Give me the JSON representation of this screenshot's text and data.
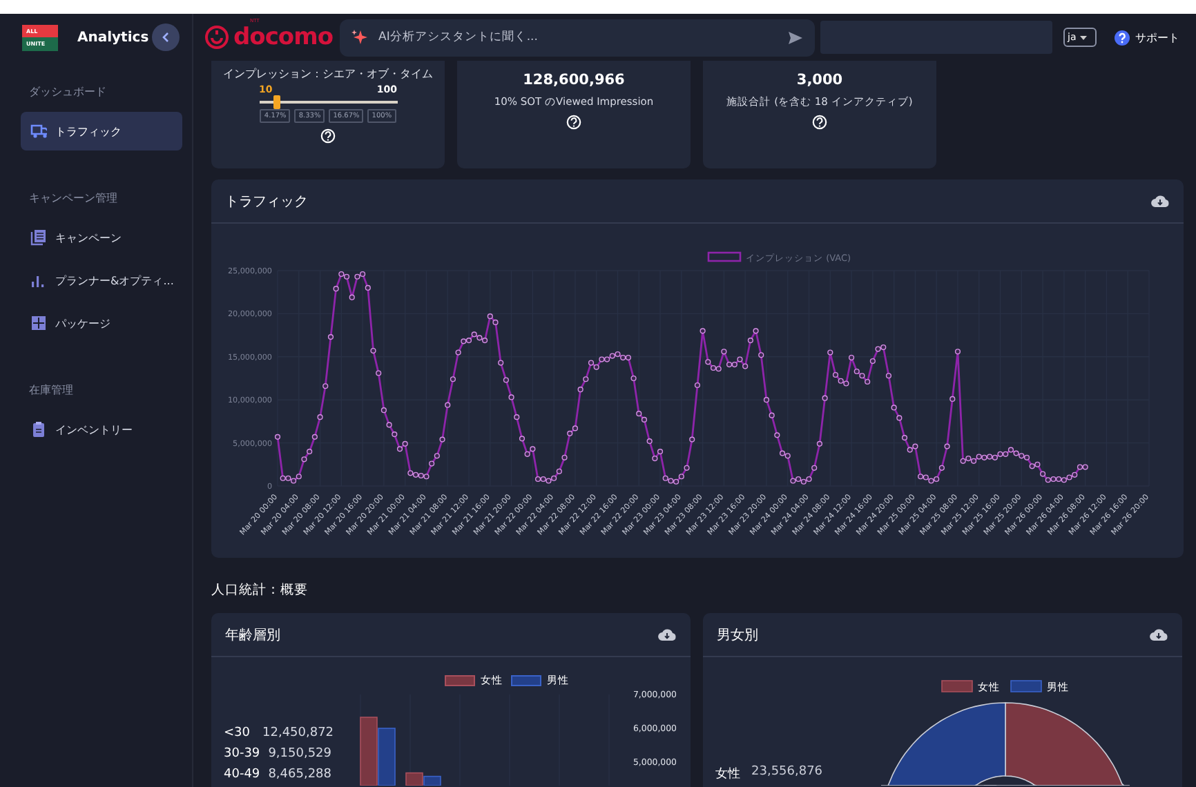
{
  "app": {
    "logo_top": "ALL",
    "logo_bottom": "UNITE",
    "title": "Analytics"
  },
  "sidebar": {
    "sections": [
      {
        "heading": "ダッシュボード",
        "items": [
          {
            "label": "トラフィック",
            "selected": true
          }
        ]
      },
      {
        "heading": "キャンペーン管理",
        "items": [
          {
            "label": "キャンペーン",
            "selected": false
          },
          {
            "label": "プランナー&オプティ...",
            "selected": false
          },
          {
            "label": "パッケージ",
            "selected": false
          }
        ]
      },
      {
        "heading": "在庫管理",
        "items": [
          {
            "label": "インベントリー",
            "selected": false
          }
        ]
      }
    ]
  },
  "header": {
    "brand": "docomo",
    "brand_super": "NTT",
    "assistant": {
      "placeholder": "AI分析アシスタントに聞く..."
    },
    "language": "ja",
    "support": "サポート"
  },
  "cards": [
    {
      "kind": "slider",
      "title": "インプレッション：シエア・オブ・タイム",
      "slider": {
        "value_label": "10",
        "max_label": "100",
        "level": 0.12
      },
      "presets": [
        "4.17%",
        "8.33%",
        "16.67%",
        "100%"
      ]
    },
    {
      "kind": "stat",
      "value": "128,600,966",
      "caption": "10% SOT のViewed Impression"
    },
    {
      "kind": "stat",
      "value": "3,000",
      "caption": "施設合計 (を含む 18 インアクティブ)"
    }
  ],
  "traffic": {
    "title": "トラフィック",
    "chart_data": {
      "type": "line",
      "grid": true,
      "ylim": [
        0,
        25000000
      ],
      "categories": [
        "Mar 20 00:00",
        null,
        null,
        null,
        "Mar 20 04:00",
        null,
        null,
        null,
        "Mar 20 08:00",
        null,
        null,
        null,
        "Mar 20 12:00",
        null,
        null,
        null,
        "Mar 20 16:00",
        null,
        null,
        null,
        "Mar 20 20:00",
        null,
        null,
        null,
        "Mar 21 00:00",
        null,
        null,
        null,
        "Mar 21 04:00",
        null,
        null,
        null,
        "Mar 21 08:00",
        null,
        null,
        null,
        "Mar 21 12:00",
        null,
        null,
        null,
        "Mar 21 16:00",
        null,
        null,
        null,
        "Mar 21 20:00",
        null,
        null,
        null,
        "Mar 22 00:00",
        null,
        null,
        null,
        "Mar 22 04:00",
        null,
        null,
        null,
        "Mar 22 08:00",
        null,
        null,
        null,
        "Mar 22 12:00",
        null,
        null,
        null,
        "Mar 22 16:00",
        null,
        null,
        null,
        "Mar 22 20:00",
        null,
        null,
        null,
        "Mar 23 00:00",
        null,
        null,
        null,
        "Mar 23 04:00",
        null,
        null,
        null,
        "Mar 23 08:00",
        null,
        null,
        null,
        "Mar 23 12:00",
        null,
        null,
        null,
        "Mar 23 16:00",
        null,
        null,
        null,
        "Mar 23 20:00",
        null,
        null,
        null,
        "Mar 24 00:00",
        null,
        null,
        null,
        "Mar 24 04:00",
        null,
        null,
        null,
        "Mar 24 08:00",
        null,
        null,
        null,
        "Mar 24 12:00",
        null,
        null,
        null,
        "Mar 24 16:00",
        null,
        null,
        null,
        "Mar 24 20:00",
        null,
        null,
        null,
        "Mar 25 00:00",
        null,
        null,
        null,
        "Mar 25 04:00",
        null,
        null,
        null,
        "Mar 25 08:00",
        null,
        null,
        null,
        "Mar 25 12:00",
        null,
        null,
        null,
        "Mar 25 16:00",
        null,
        null,
        null,
        "Mar 25 20:00",
        null,
        null,
        null,
        "Mar 26 00:00",
        null,
        null,
        null,
        "Mar 26 04:00",
        null,
        null,
        null,
        "Mar 26 08:00",
        null,
        null,
        null,
        "Mar 26 12:00",
        null,
        null,
        null,
        "Mar 26 16:00",
        null,
        null,
        null,
        "Mar 26 20:00"
      ],
      "yticks": [
        {
          "value": 0,
          "label": "0"
        },
        {
          "value": 5000000,
          "label": "5,000,000"
        },
        {
          "value": 10000000,
          "label": "10,000,000"
        },
        {
          "value": 15000000,
          "label": "15,000,000"
        },
        {
          "value": 20000000,
          "label": "20,000,000"
        },
        {
          "value": 25000000,
          "label": "25,000,000"
        }
      ],
      "series": [
        {
          "name": "インプレッション (VAC)",
          "color": "#8e24aa",
          "marker": "circle",
          "values": [
            5700000,
            900000,
            900000,
            600000,
            1100000,
            3100000,
            4000000,
            5700000,
            8000000,
            11600000,
            17300000,
            22900000,
            24600000,
            24300000,
            21900000,
            24300000,
            24600000,
            23000000,
            15700000,
            13100000,
            8800000,
            7100000,
            6000000,
            4300000,
            4900000,
            1500000,
            1300000,
            1200000,
            1100000,
            2600000,
            3500000,
            5400000,
            9400000,
            12400000,
            15500000,
            16800000,
            16900000,
            17600000,
            17200000,
            16900000,
            19700000,
            19000000,
            14300000,
            12300000,
            10300000,
            8000000,
            5500000,
            3700000,
            4300000,
            800000,
            800000,
            600000,
            900000,
            1700000,
            3300000,
            6100000,
            6700000,
            11200000,
            12400000,
            14300000,
            13800000,
            14700000,
            14700000,
            15100000,
            15300000,
            14900000,
            14900000,
            12500000,
            8400000,
            7700000,
            5200000,
            3200000,
            4000000,
            900000,
            600000,
            500000,
            1100000,
            2100000,
            5400000,
            11700000,
            18000000,
            14400000,
            13700000,
            13600000,
            15600000,
            14100000,
            14100000,
            14700000,
            13900000,
            16900000,
            18000000,
            15200000,
            10000000,
            8200000,
            5900000,
            3800000,
            3500000,
            600000,
            800000,
            500000,
            800000,
            2100000,
            4900000,
            10200000,
            15500000,
            12900000,
            12200000,
            11900000,
            14900000,
            13300000,
            12800000,
            12100000,
            14500000,
            15900000,
            16100000,
            12800000,
            9100000,
            7900000,
            5600000,
            4200000,
            4600000,
            1100000,
            1000000,
            600000,
            800000,
            2100000,
            4600000,
            10100000,
            15600000,
            2900000,
            3200000,
            2900000,
            3400000,
            3300000,
            3400000,
            3300000,
            3700000,
            3700000,
            4200000,
            3800000,
            3500000,
            3300000,
            2300000,
            2500000,
            1400000,
            700000,
            800000,
            800000,
            700000,
            1000000,
            1300000,
            2200000,
            2200000,
            null,
            null,
            null,
            null,
            null,
            null,
            null,
            null,
            null,
            null,
            null,
            null
          ]
        }
      ]
    }
  },
  "demographics": {
    "heading": "人口統計：概要",
    "panels": [
      {
        "kind": "age",
        "title": "年齢層別",
        "rows": [
          {
            "label": "<30",
            "value": "12,450,872"
          },
          {
            "label": "30-39",
            "value": "9,150,529"
          },
          {
            "label": "40-49",
            "value": "8,465,288"
          }
        ],
        "legend": [
          {
            "label": "女性",
            "color": "#7a3742"
          },
          {
            "label": "男性",
            "color": "#23408a"
          }
        ],
        "axis_labels": [
          "7,000,000",
          "6,000,000",
          "5,000,000"
        ]
      },
      {
        "kind": "gender",
        "title": "男女別",
        "legend": [
          {
            "label": "女性",
            "color": "#7a3742"
          },
          {
            "label": "男性",
            "color": "#23408a"
          }
        ],
        "callout": {
          "label": "女性",
          "value": "23,556,876"
        }
      }
    ]
  }
}
